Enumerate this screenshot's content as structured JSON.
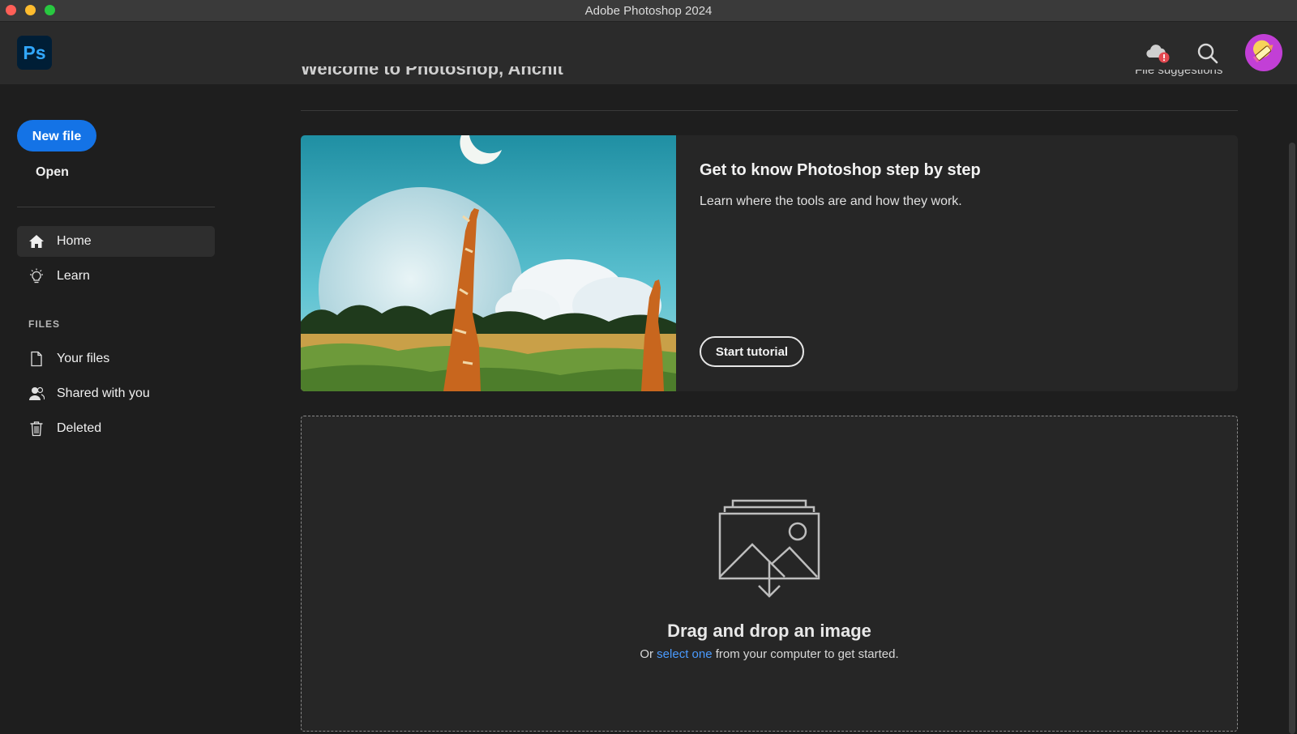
{
  "window": {
    "title": "Adobe Photoshop 2024",
    "traffic_lights": [
      "close",
      "minimize",
      "zoom"
    ]
  },
  "header": {
    "app_logo_text": "Ps",
    "icons": [
      "cloud-status-icon",
      "search-icon",
      "avatar"
    ]
  },
  "sidebar": {
    "new_file_label": "New file",
    "open_label": "Open",
    "nav": [
      {
        "label": "Home",
        "icon": "home-icon",
        "active": true
      },
      {
        "label": "Learn",
        "icon": "lightbulb-icon",
        "active": false
      }
    ],
    "files_heading": "FILES",
    "files": [
      {
        "label": "Your files",
        "icon": "document-icon"
      },
      {
        "label": "Shared with you",
        "icon": "people-icon"
      },
      {
        "label": "Deleted",
        "icon": "trash-icon"
      }
    ]
  },
  "main": {
    "welcome_text": "Welcome to Photoshop, Anchit",
    "file_suggestions_label": "File suggestions",
    "tutorial_card": {
      "title": "Get to know Photoshop step by step",
      "description": "Learn where the tools are and how they work.",
      "button_label": "Start tutorial"
    },
    "dropzone": {
      "title": "Drag and drop an image",
      "sub_prefix": "Or ",
      "sub_link": "select one",
      "sub_suffix": " from your computer to get started."
    }
  },
  "colors": {
    "accent": "#1473e6",
    "link": "#4a9bff",
    "ps_logo_bg": "#001e36",
    "ps_logo_text": "#31a8ff"
  }
}
